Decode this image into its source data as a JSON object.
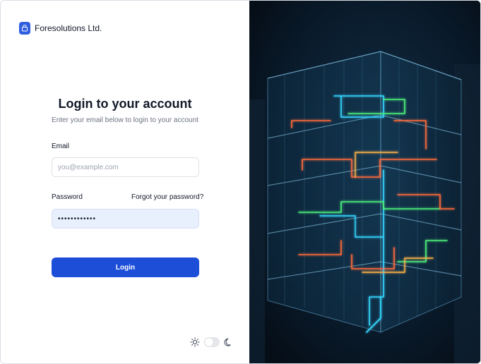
{
  "brand": {
    "name": "Foresolutions Ltd.",
    "logo_icon": "lock-icon",
    "accent": "#2f5fe0"
  },
  "login": {
    "title": "Login to your account",
    "subtitle": "Enter your email below to login to your account",
    "email_label": "Email",
    "email_placeholder": "you@example.com",
    "password_label": "Password",
    "forgot_label": "Forgot your password?",
    "password_value": "••••••••••••",
    "button_label": "Login",
    "button_color": "#1d4ed8"
  },
  "theme": {
    "light_icon": "sun-icon",
    "dark_icon": "moon-icon",
    "mode": "light"
  },
  "hero": {
    "description_icon": "circuit-building-illustration"
  }
}
